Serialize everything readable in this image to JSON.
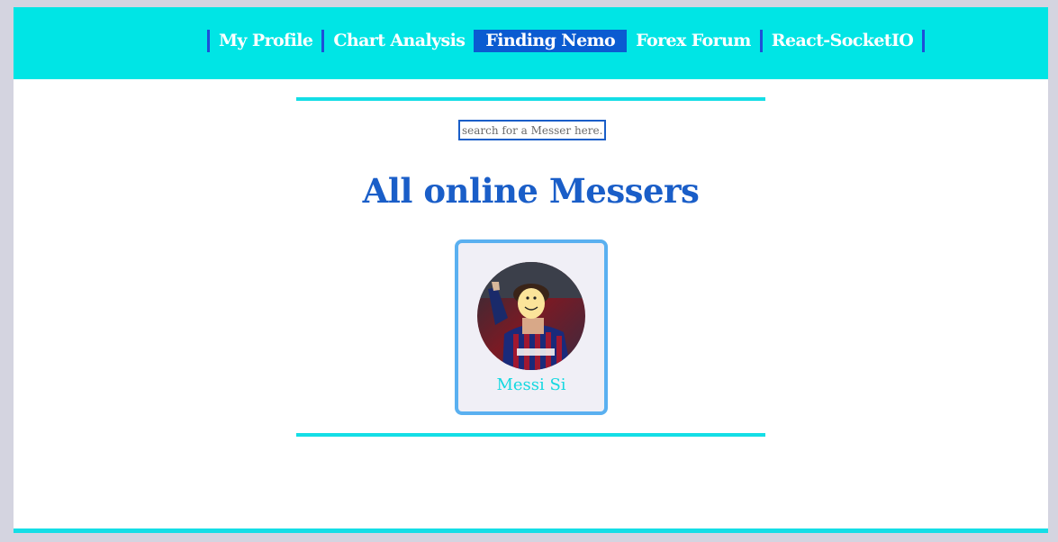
{
  "nav": {
    "items": [
      {
        "label": "My Profile",
        "active": false
      },
      {
        "label": "Chart Analysis",
        "active": false
      },
      {
        "label": "Finding Nemo",
        "active": true
      },
      {
        "label": "Forex Forum",
        "active": false
      },
      {
        "label": "React-SocketIO",
        "active": false
      }
    ]
  },
  "search": {
    "placeholder": "search for a Messer here..."
  },
  "main": {
    "title": "All online Messers"
  },
  "users": [
    {
      "name": "Messi Si",
      "avatar": "user-avatar-photo"
    }
  ],
  "colors": {
    "navbar_bg": "#00e5e5",
    "active_tab": "#0a5bd1",
    "accent": "#1a5ec8",
    "rule": "#14dee6",
    "card_border": "#5ab0f0"
  }
}
